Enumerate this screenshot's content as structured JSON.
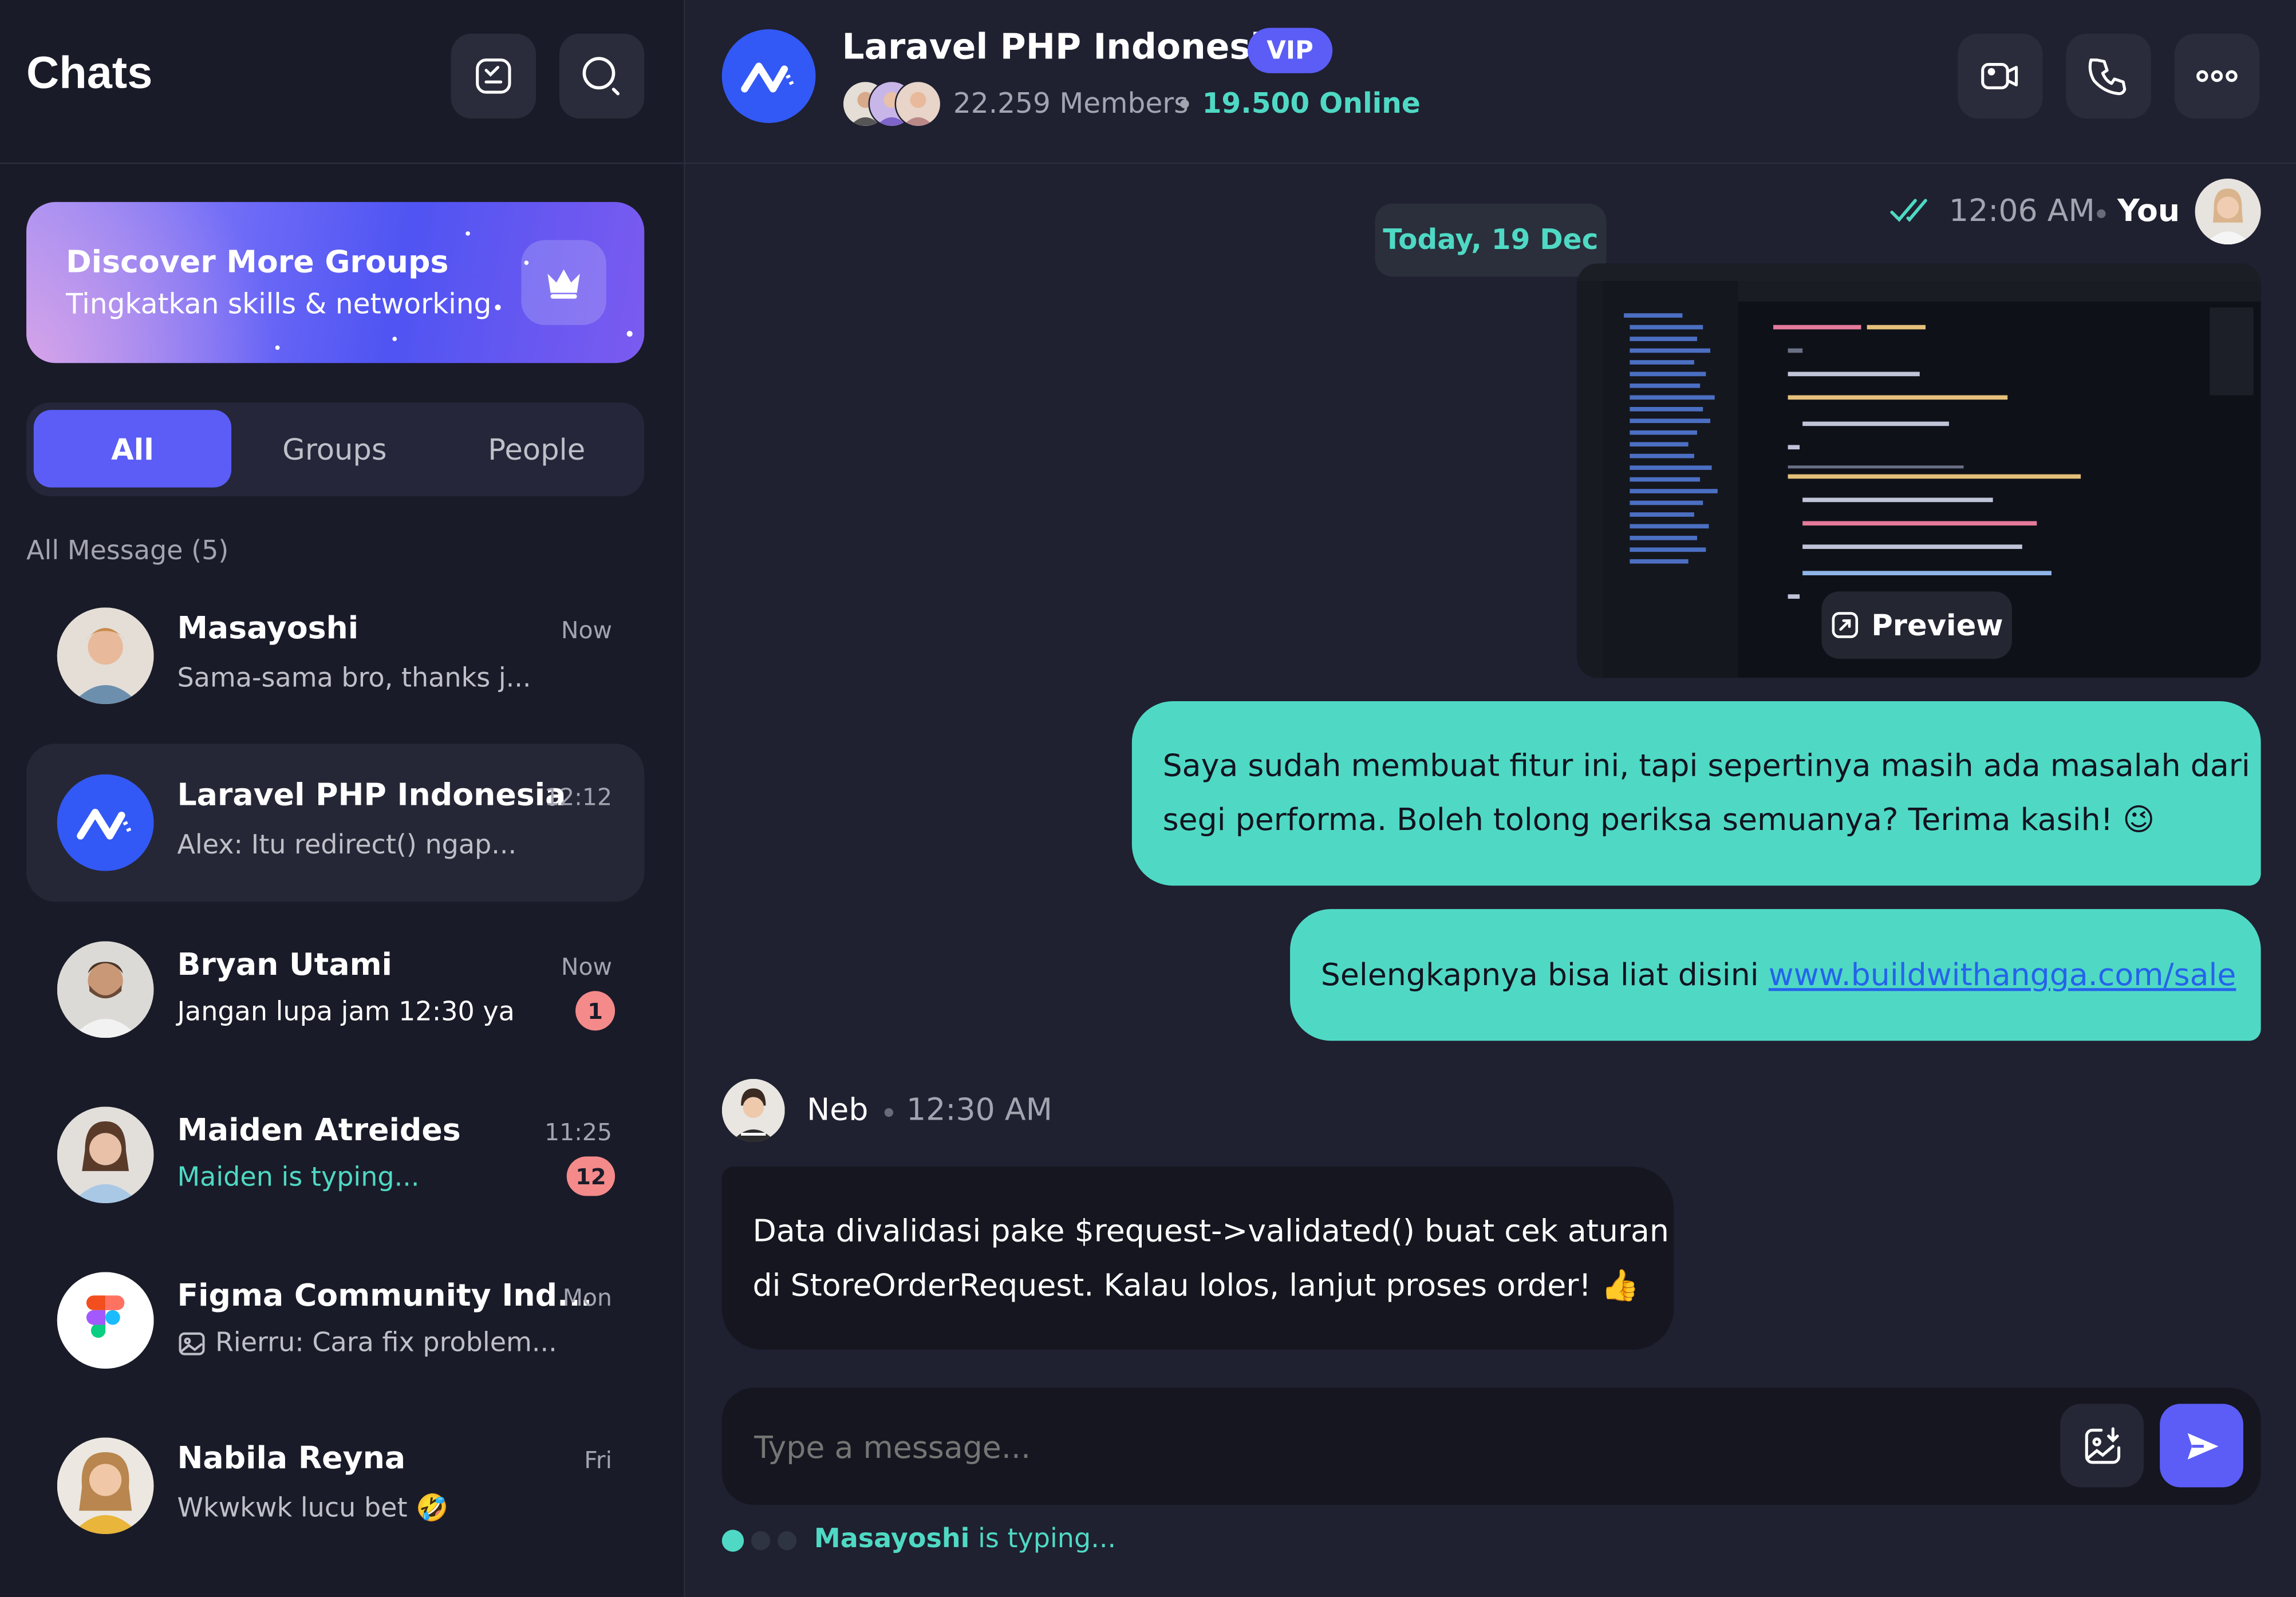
{
  "sidebar": {
    "title": "Chats",
    "new_chat_icon": "compose-icon",
    "search_icon": "search-icon",
    "banner": {
      "title": "Discover More Groups",
      "subtitle": "Tingkatkan skills & networking",
      "icon": "crown-icon"
    },
    "tabs": [
      {
        "label": "All",
        "active": true
      },
      {
        "label": "Groups",
        "active": false
      },
      {
        "label": "People",
        "active": false
      }
    ],
    "section_label": "All Message (5)",
    "chats": [
      {
        "name": "Masayoshi",
        "time": "Now",
        "preview": "Sama-sama bro, thanks j...",
        "badge": ""
      },
      {
        "name": "Laravel PHP Indonesia",
        "time": "12:12",
        "preview": "Alex: Itu redirect() ngap...",
        "badge": ""
      },
      {
        "name": "Bryan Utami",
        "time": "Now",
        "preview": "Jangan lupa jam 12:30 ya",
        "badge": "1"
      },
      {
        "name": "Maiden Atreides",
        "time": "11:25",
        "preview": "Maiden is typing...",
        "badge": "12"
      },
      {
        "name": "Figma Community Ind...",
        "time": "Mon",
        "preview": "Rierru: Cara fix problem...",
        "badge": ""
      },
      {
        "name": "Nabila Reyna",
        "time": "Fri",
        "preview": "Wkwkwk lucu bet 🤣",
        "badge": ""
      }
    ]
  },
  "header": {
    "group_name": "Laravel PHP Indonesia",
    "vip_label": "VIP",
    "members": "22.259 Members",
    "online": "19.500 Online",
    "video_icon": "video-call-icon",
    "phone_icon": "phone-icon",
    "more_icon": "more-icon"
  },
  "conversation": {
    "date_label": "Today, 19 Dec",
    "my_meta": {
      "time": "12:06 AM",
      "sender": "You"
    },
    "preview_label": "Preview",
    "my_messages": [
      {
        "line1": "Saya sudah membuat fitur ini, tapi sepertinya masih ada masalah dari",
        "line2": "segi performa. Boleh tolong periksa semuanya? Terima kasih! 😉"
      },
      {
        "text": "Selengkapnya bisa liat disini ",
        "link": "www.buildwithangga.com/sale"
      }
    ],
    "other_meta": {
      "sender": "Neb",
      "time": "12:30 AM"
    },
    "other_message": {
      "line1": "Data divalidasi pake $request->validated() buat cek aturan",
      "line2": "di StoreOrderRequest. Kalau lolos, lanjut proses order! 👍"
    }
  },
  "composer": {
    "placeholder": "Type a message...",
    "attach_icon": "image-upload-icon",
    "send_icon": "send-icon"
  },
  "typing": {
    "name": "Masayoshi",
    "text": "is typing..."
  },
  "colors": {
    "accent": "#5b5df6",
    "teal": "#4fd9c4",
    "badge": "#f48a8a",
    "bg": "#1c1d2b"
  }
}
